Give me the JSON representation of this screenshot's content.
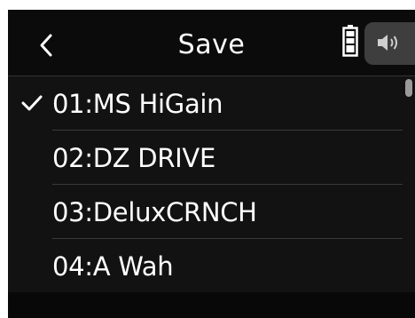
{
  "header": {
    "title": "Save",
    "back_icon": "chevron-left-icon",
    "battery_icon": "battery-icon",
    "speaker_icon": "speaker-icon"
  },
  "list": {
    "items": [
      {
        "label": "01:MS HiGain",
        "selected": true
      },
      {
        "label": "02:DZ DRIVE",
        "selected": false
      },
      {
        "label": "03:DeluxCRNCH",
        "selected": false
      },
      {
        "label": "04:A Wah",
        "selected": false
      }
    ]
  },
  "colors": {
    "background": "#121212",
    "header": "#0b0b0b",
    "text": "#ffffff",
    "divider": "#3a3a3a",
    "speaker_tab": "#3e3e3e"
  }
}
